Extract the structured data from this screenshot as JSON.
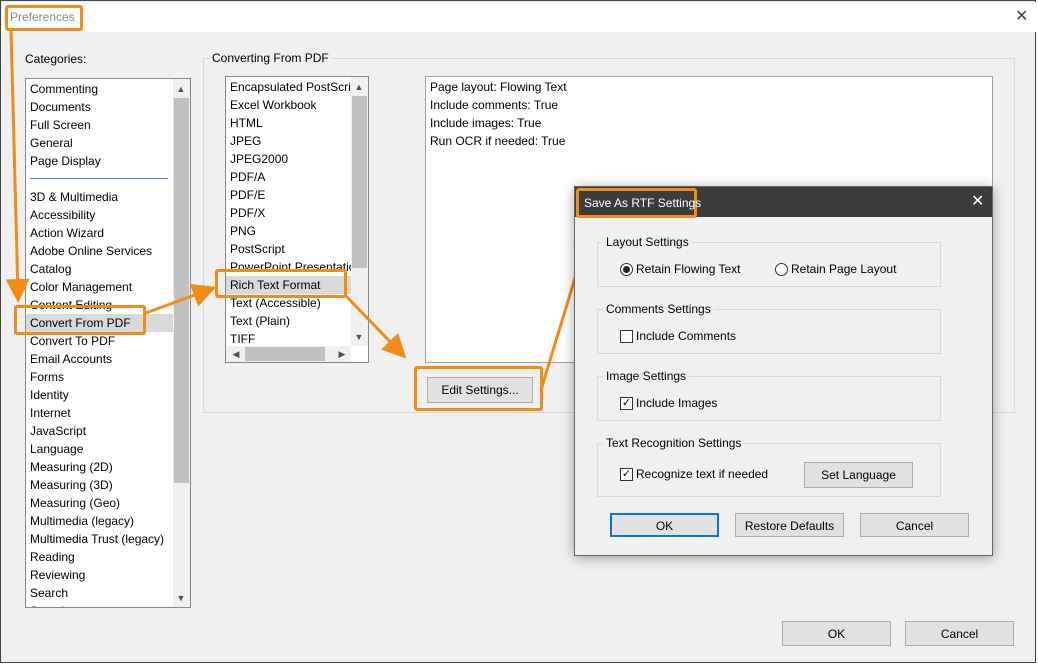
{
  "window": {
    "title": "Preferences"
  },
  "categories": {
    "label": "Categories:",
    "group_top": [
      "Commenting",
      "Documents",
      "Full Screen",
      "General",
      "Page Display"
    ],
    "group_bottom": [
      "3D & Multimedia",
      "Accessibility",
      "Action Wizard",
      "Adobe Online Services",
      "Catalog",
      "Color Management",
      "Content Editing",
      "Convert From PDF",
      "Convert To PDF",
      "Email Accounts",
      "Forms",
      "Identity",
      "Internet",
      "JavaScript",
      "Language",
      "Measuring (2D)",
      "Measuring (3D)",
      "Measuring (Geo)",
      "Multimedia (legacy)",
      "Multimedia Trust (legacy)",
      "Reading",
      "Reviewing",
      "Search",
      "Security"
    ],
    "selected": "Convert From PDF"
  },
  "converting": {
    "group_label": "Converting From PDF",
    "formats": [
      "Encapsulated PostScript",
      "Excel Workbook",
      "HTML",
      "JPEG",
      "JPEG2000",
      "PDF/A",
      "PDF/E",
      "PDF/X",
      "PNG",
      "PostScript",
      "PowerPoint Presentation",
      "Rich Text Format",
      "Text (Accessible)",
      "Text (Plain)",
      "TIFF"
    ],
    "selected": "Rich Text Format",
    "settings_summary": [
      "Page layout: Flowing Text",
      "Include comments: True",
      "Include images: True",
      "Run OCR if needed: True"
    ],
    "edit_settings_label": "Edit Settings..."
  },
  "footer": {
    "ok_label": "OK",
    "cancel_label": "Cancel"
  },
  "rtf_dialog": {
    "title": "Save As RTF Settings",
    "layout": {
      "label": "Layout Settings",
      "retain_flowing": "Retain Flowing Text",
      "retain_page": "Retain Page Layout",
      "selected": "Retain Flowing Text"
    },
    "comments": {
      "label": "Comments Settings",
      "include_comments": "Include Comments",
      "checked": false
    },
    "images": {
      "label": "Image Settings",
      "include_images": "Include Images",
      "checked": true
    },
    "ocr": {
      "label": "Text Recognition Settings",
      "recognize": "Recognize text if needed",
      "checked": true,
      "set_language_label": "Set Language"
    },
    "ok_label": "OK",
    "restore_label": "Restore Defaults",
    "cancel_label": "Cancel"
  },
  "colors": {
    "highlight": "#f28c17",
    "focus_blue": "#0078d7",
    "title_dark": "#3c3c3c"
  }
}
